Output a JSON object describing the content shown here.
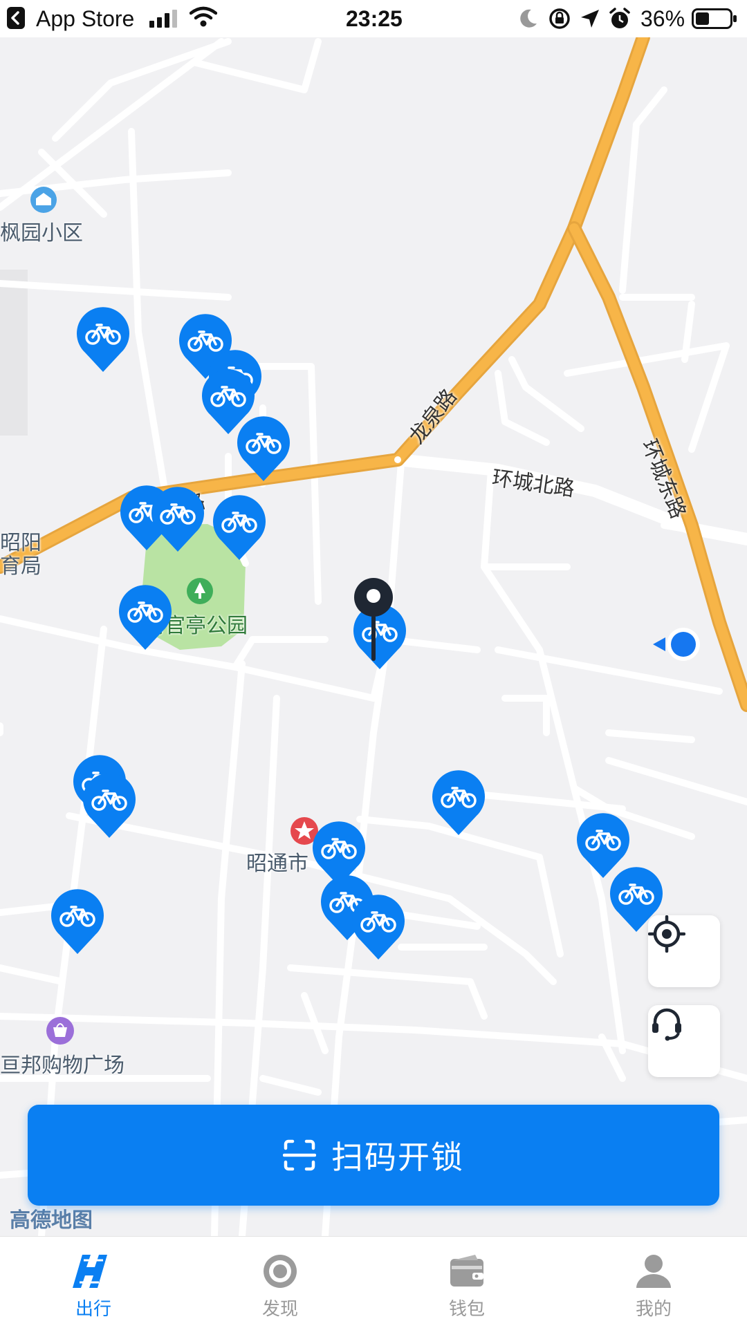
{
  "status_bar": {
    "back_app": "App Store",
    "time": "23:25",
    "battery": "36%"
  },
  "map": {
    "place_labels": {
      "fengyuan": "枫园小区",
      "zhaoyang": "昭阳",
      "yuju": "育局",
      "park": "清官亭公园",
      "city": "昭通市",
      "mall": "亘邦购物广场"
    },
    "road_labels": {
      "longquan": "龙泉路",
      "huancheng_north_left": "环城北路",
      "huancheng_north_right": "环城北路",
      "huancheng_east": "环城东路"
    },
    "attribution": "高德地图",
    "marker_color": "#0a7ff2",
    "bike_count": 19
  },
  "scan_button": {
    "label": "扫码开锁"
  },
  "tabs": [
    {
      "label": "出行",
      "icon": "ride-icon",
      "active": true
    },
    {
      "label": "发现",
      "icon": "discover-icon",
      "active": false
    },
    {
      "label": "钱包",
      "icon": "wallet-icon",
      "active": false
    },
    {
      "label": "我的",
      "icon": "profile-icon",
      "active": false
    }
  ],
  "colors": {
    "accent": "#0a7ff2",
    "road_major": "#f7b548",
    "park": "#b9e3a3"
  }
}
